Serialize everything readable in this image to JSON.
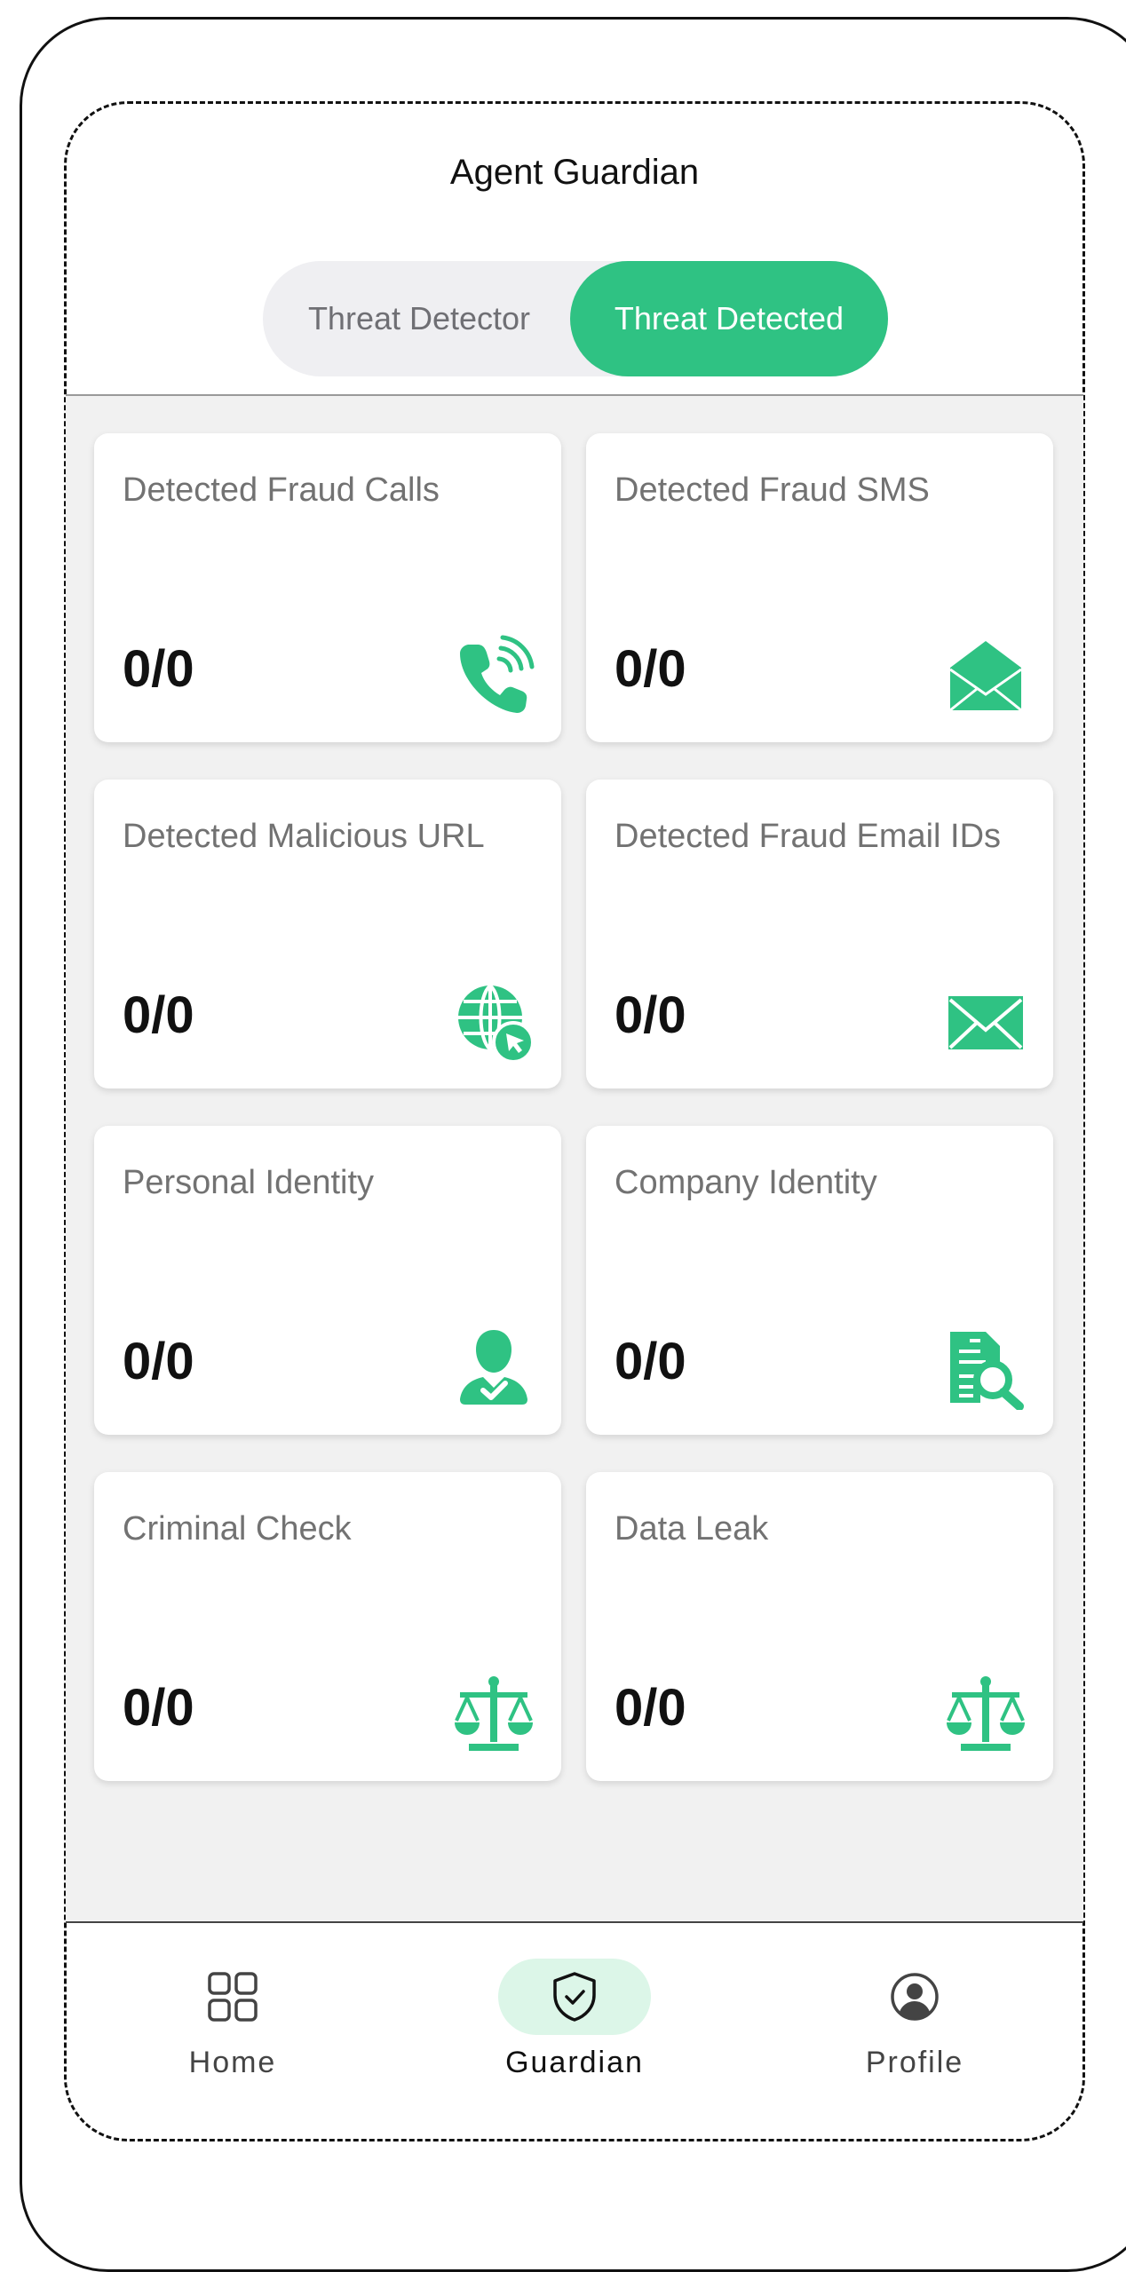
{
  "app": {
    "title": "Agent Guardian"
  },
  "tabs": [
    {
      "label": "Threat Detector",
      "active": false
    },
    {
      "label": "Threat Detected",
      "active": true
    }
  ],
  "cards": [
    {
      "title": "Detected Fraud Calls",
      "count": "0/0",
      "icon": "phone-ringing-icon"
    },
    {
      "title": "Detected Fraud SMS",
      "count": "0/0",
      "icon": "open-envelope-icon"
    },
    {
      "title": "Detected Malicious URL",
      "count": "0/0",
      "icon": "globe-cursor-icon"
    },
    {
      "title": "Detected Fraud Email IDs",
      "count": "0/0",
      "icon": "envelope-icon"
    },
    {
      "title": "Personal Identity",
      "count": "0/0",
      "icon": "user-check-icon"
    },
    {
      "title": "Company Identity",
      "count": "0/0",
      "icon": "document-search-icon"
    },
    {
      "title": "Criminal Check",
      "count": "0/0",
      "icon": "scales-icon"
    },
    {
      "title": "Data Leak",
      "count": "0/0",
      "icon": "scales-icon"
    }
  ],
  "nav": [
    {
      "label": "Home",
      "icon": "grid-icon",
      "active": false
    },
    {
      "label": "Guardian",
      "icon": "shield-check-icon",
      "active": true
    },
    {
      "label": "Profile",
      "icon": "user-circle-icon",
      "active": false
    }
  ],
  "colors": {
    "accent": "#2fc283",
    "accent_soft": "#dcf6e8",
    "background": "#f1f1f1"
  }
}
